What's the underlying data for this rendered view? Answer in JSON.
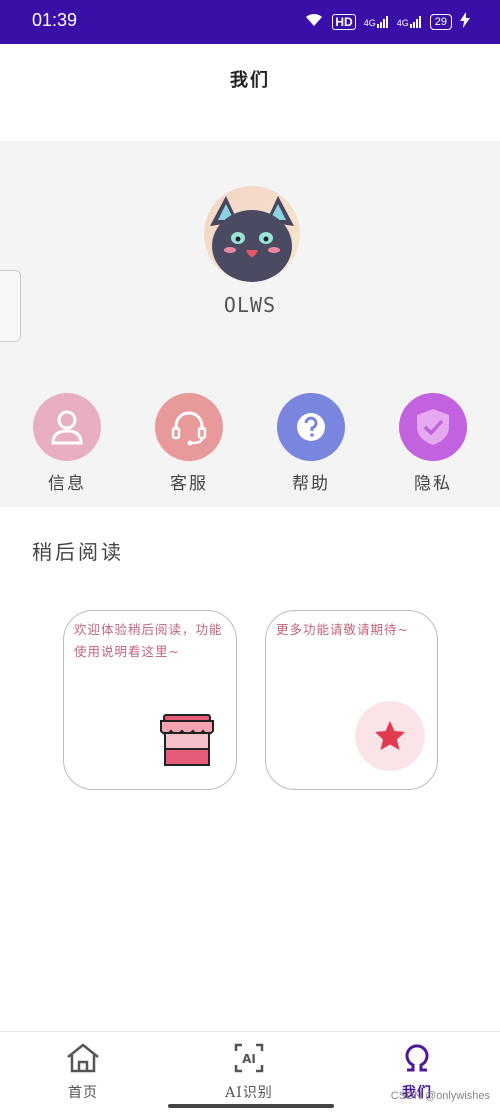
{
  "status_bar": {
    "time": "01:39",
    "network_1": "4G",
    "network_2": "4G",
    "hd_badge": "HD",
    "battery": "29"
  },
  "header": {
    "title": "我们"
  },
  "profile": {
    "username": "OLWS"
  },
  "menu": [
    {
      "label": "信息",
      "icon": "user-icon",
      "color": "#e8afc0"
    },
    {
      "label": "客服",
      "icon": "headset-icon",
      "color": "#e89a9a"
    },
    {
      "label": "帮助",
      "icon": "help-icon",
      "color": "#7a86de"
    },
    {
      "label": "隐私",
      "icon": "shield-check-icon",
      "color": "#c362df"
    }
  ],
  "read_later": {
    "title": "稍后阅读",
    "card1_text": "欢迎体验稍后阅读，功能使用说明看这里~",
    "card2_text": "更多功能请敬请期待~"
  },
  "tabs": [
    {
      "label": "首页",
      "icon": "home-icon"
    },
    {
      "label": "AI识别",
      "icon": "ai-scan-icon"
    },
    {
      "label": "我们",
      "icon": "omega-icon",
      "active": true
    }
  ],
  "colors": {
    "status_bar": "#3a0fa8",
    "active_tab": "#4a1a9c",
    "card_text": "#c4637a"
  },
  "watermark": "CSDN @onlywishes"
}
